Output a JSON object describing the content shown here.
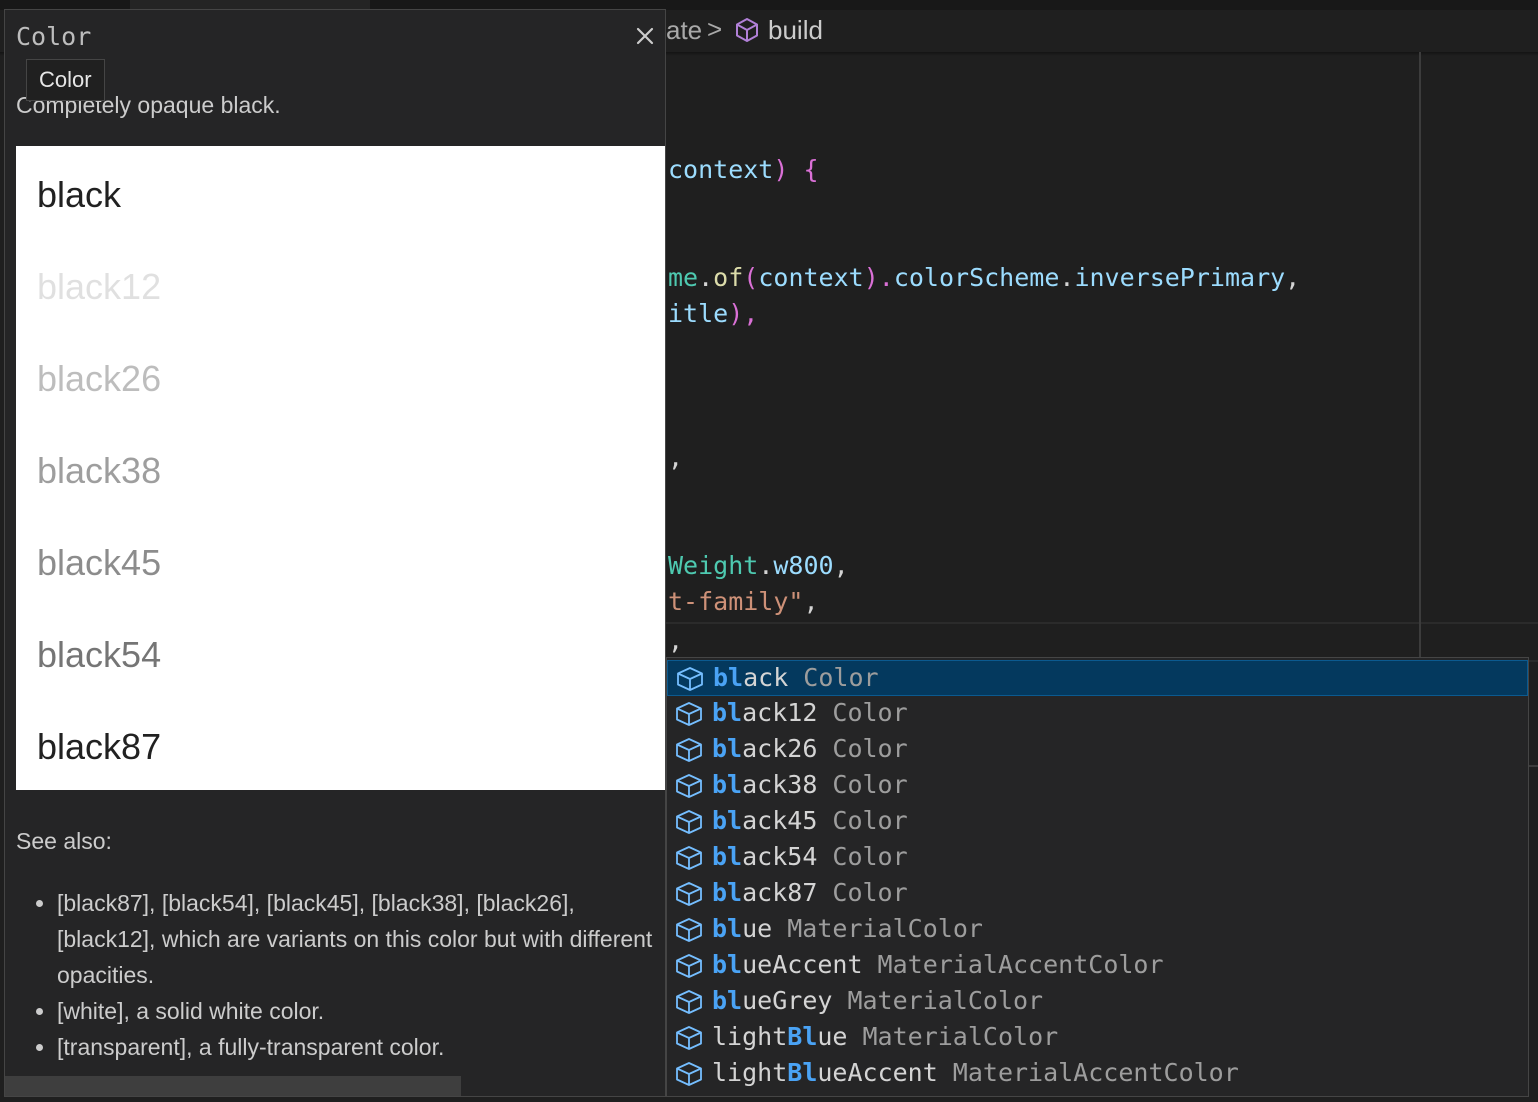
{
  "breadcrumb": {
    "part": "ate",
    "separator": ">",
    "item": "build",
    "item_icon": "cube-icon"
  },
  "code": {
    "line1": {
      "a": "context",
      "b": ") {"
    },
    "line2": {
      "a": "me",
      "b": ".",
      "c": "of",
      "d": "(",
      "e": "context",
      "f": ").",
      "g": "colorScheme",
      "h": ".",
      "i": "inversePrimary",
      "j": ","
    },
    "line3": {
      "a": "itle",
      "b": "),",
      "c": ""
    },
    "line4": {
      "a": ","
    },
    "line5": {
      "a": "Weight",
      "b": ".",
      "c": "w800",
      "d": ","
    },
    "line6": {
      "a": "t-family\"",
      "b": ","
    },
    "line7": {
      "a": ","
    }
  },
  "doc": {
    "title": "Color",
    "tooltip": "Color",
    "summary": "Completely opaque black.",
    "swatches": [
      "black",
      "black12",
      "black26",
      "black38",
      "black45",
      "black54",
      "black87"
    ],
    "swatch_opacities": [
      0.87,
      0.12,
      0.26,
      0.38,
      0.45,
      0.54,
      0.87
    ],
    "see_also": "See also:",
    "bullets": [
      "[black87], [black54], [black45], [black38], [black26], [black12], which are variants on this color but with different opacities.",
      "[white], a solid white color.",
      "[transparent], a fully-transparent color."
    ]
  },
  "suggestions": [
    {
      "label": "black",
      "match": "bl",
      "detail": "Color",
      "selected": true
    },
    {
      "label": "black12",
      "match": "bl",
      "detail": "Color",
      "selected": false
    },
    {
      "label": "black26",
      "match": "bl",
      "detail": "Color",
      "selected": false
    },
    {
      "label": "black38",
      "match": "bl",
      "detail": "Color",
      "selected": false
    },
    {
      "label": "black45",
      "match": "bl",
      "detail": "Color",
      "selected": false
    },
    {
      "label": "black54",
      "match": "bl",
      "detail": "Color",
      "selected": false
    },
    {
      "label": "black87",
      "match": "bl",
      "detail": "Color",
      "selected": false
    },
    {
      "label": "blue",
      "match": "bl",
      "detail": "MaterialColor",
      "selected": false
    },
    {
      "label": "blueAccent",
      "match": "bl",
      "detail": "MaterialAccentColor",
      "selected": false
    },
    {
      "label": "blueGrey",
      "match": "bl",
      "detail": "MaterialColor",
      "selected": false
    },
    {
      "label": "lightBlue",
      "match": "Bl",
      "detail": "MaterialColor",
      "selected": false
    },
    {
      "label": "lightBlueAccent",
      "match": "Bl",
      "detail": "MaterialAccentColor",
      "selected": false
    }
  ],
  "colors": {
    "accent": "#4aa3f5",
    "selected_row": "#04395e",
    "panel_bg": "#252526",
    "editor_bg": "#1f1f1f"
  }
}
